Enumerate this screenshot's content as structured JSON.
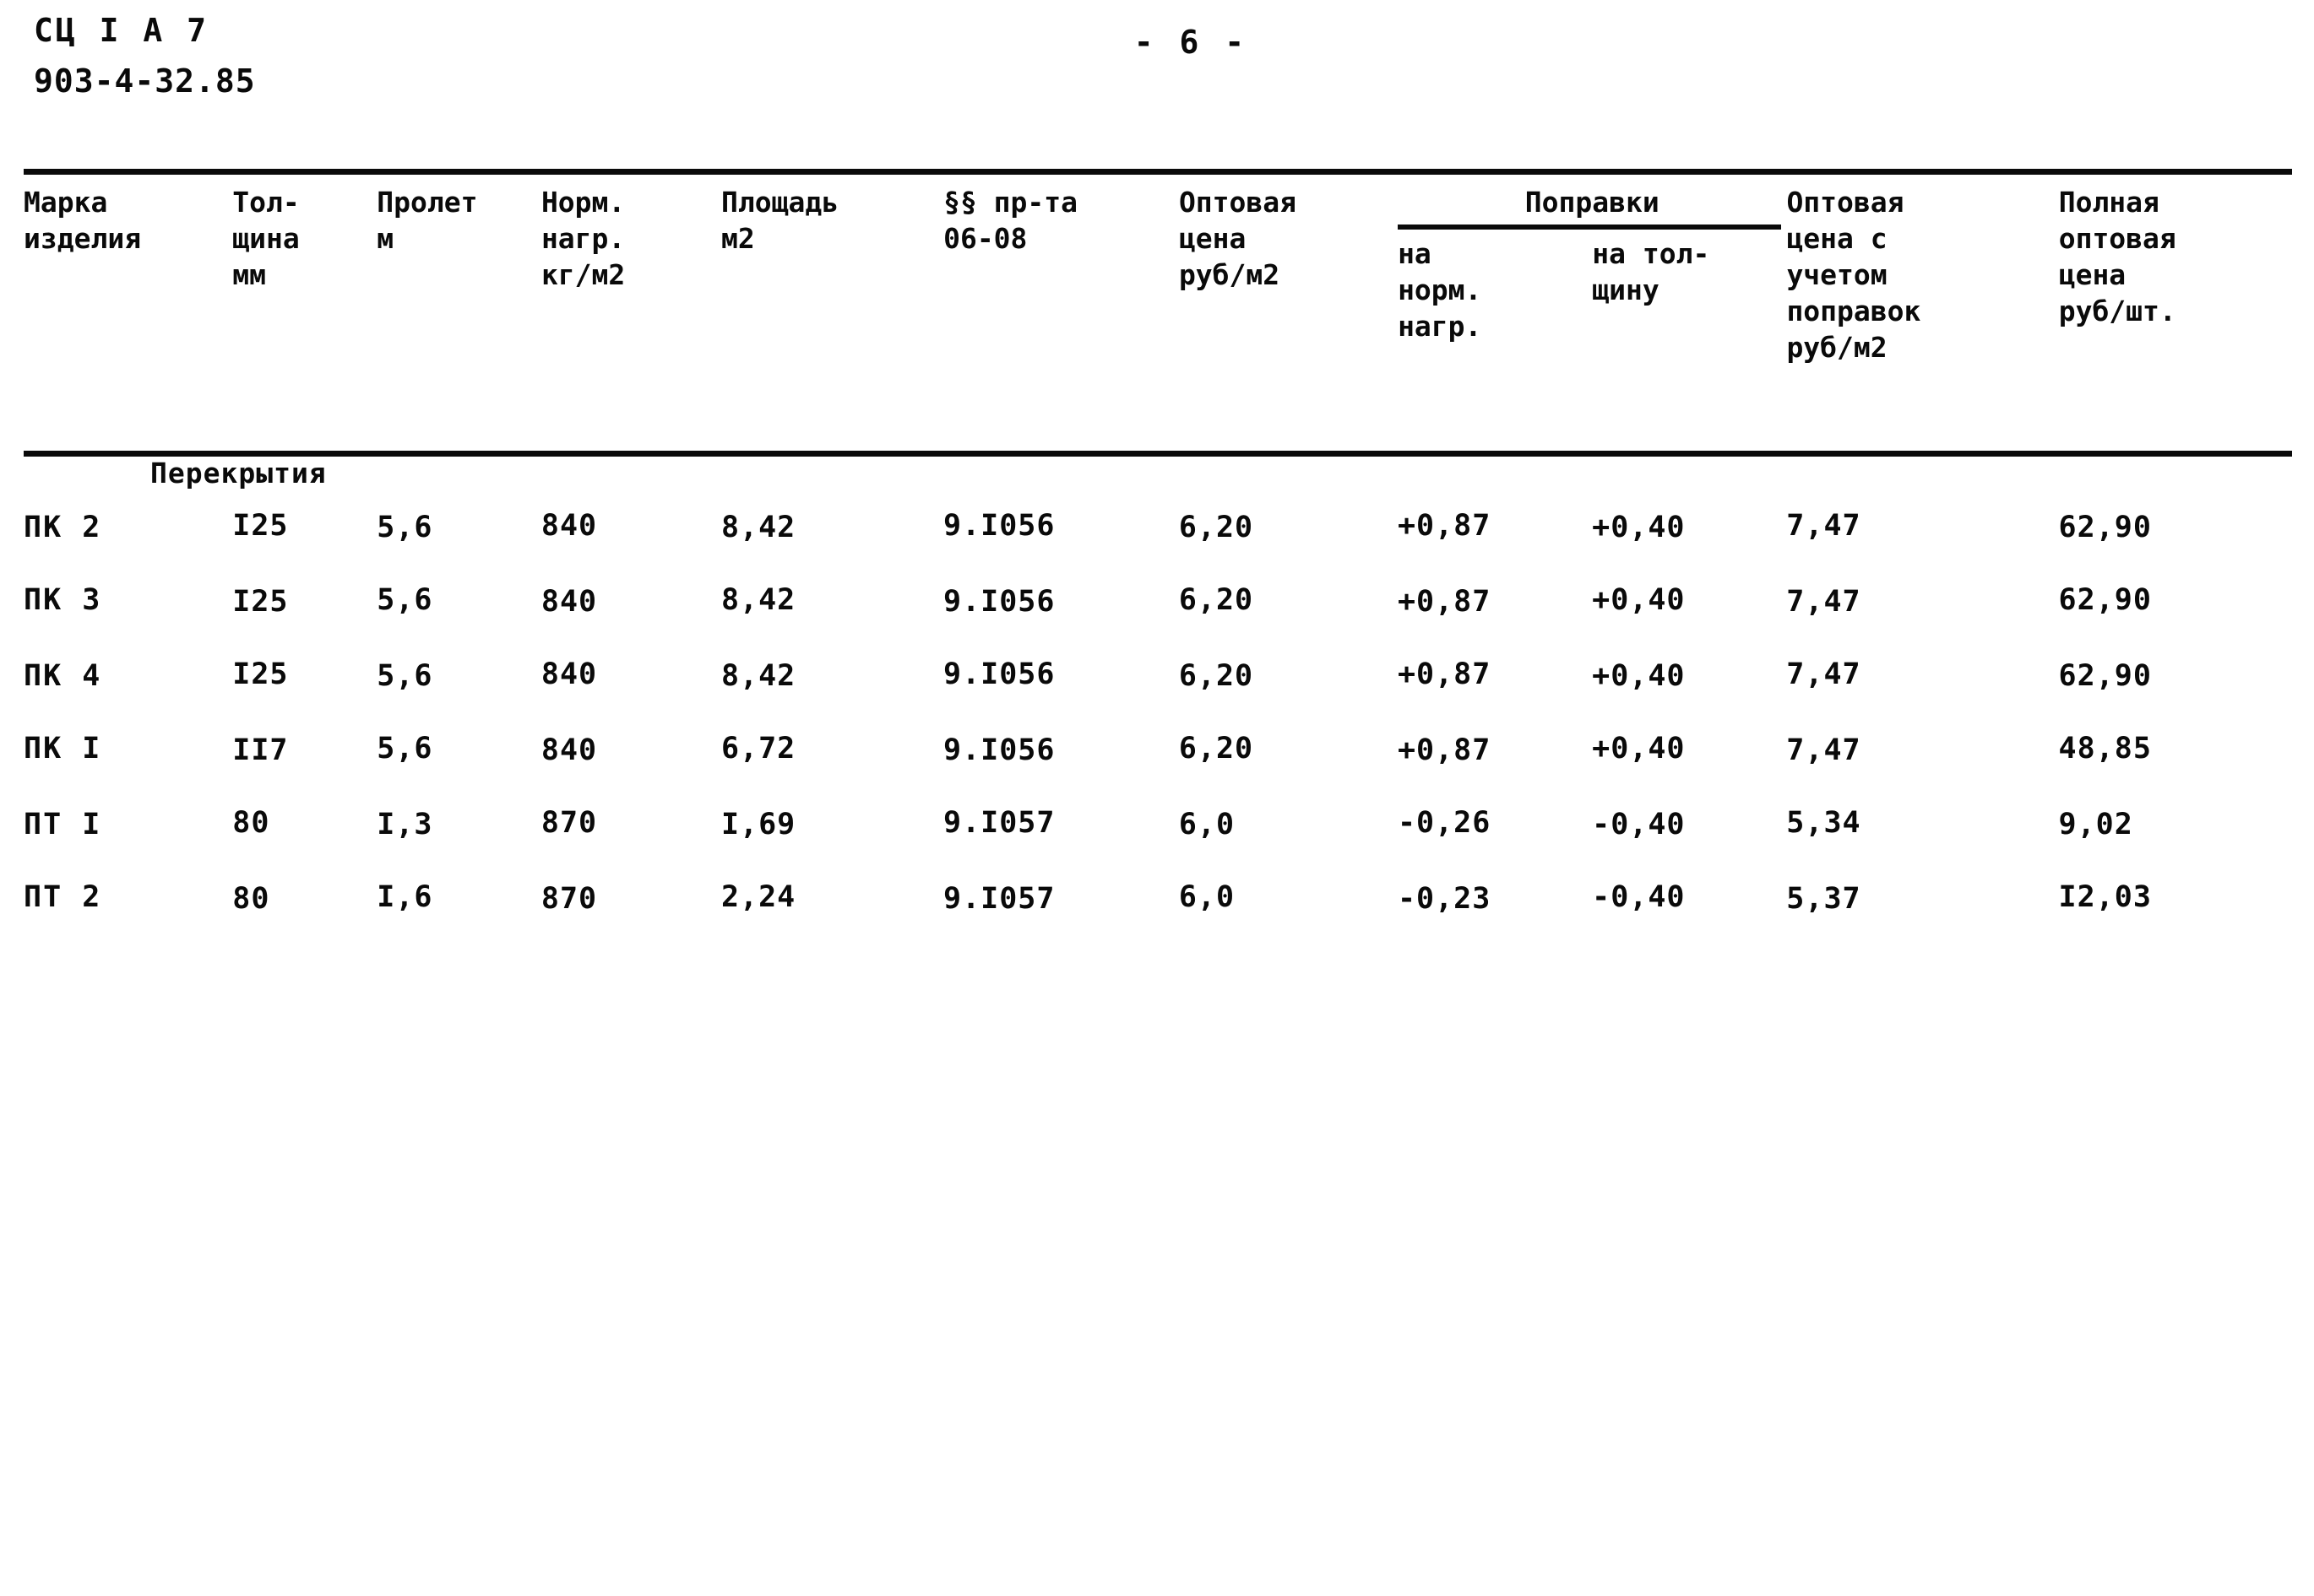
{
  "document": {
    "code": "СЦ I A 7",
    "series": "903-4-32.85",
    "page_number": "- 6 -"
  },
  "table": {
    "headers": {
      "mark": "Марка\nизделия",
      "thickness": "Тол-\nщина\nмм",
      "span": "Пролет\nм",
      "norm_load": "Норм.\nнагр.\nкг/м2",
      "area": "Площадь\nм2",
      "paragraphs": "§§ пр-та\n06-08",
      "wholesale_price": "Оптовая\nцена\nруб/м2",
      "corrections_group": "Поправки",
      "correction_load": "на\nнорм.\nнагр.",
      "correction_thickness": "на тол-\nщину",
      "price_with_corrections": "Оптовая\nцена с\nучетом\nпоправок\nруб/м2",
      "full_price": "Полная\nоптовая\nцена\nруб/шт."
    },
    "sections": [
      {
        "label": "Перекрытия",
        "rows": [
          {
            "mark": "ПК 2",
            "thickness": "I25",
            "span": "5,6",
            "norm_load": "840",
            "area": "8,42",
            "paragraphs": "9.I056",
            "wholesale_price": "6,20",
            "correction_load": "+0,87",
            "correction_thickness": "+0,40",
            "price_with_corrections": "7,47",
            "full_price": "62,90"
          },
          {
            "mark": "ПК 3",
            "thickness": "I25",
            "span": "5,6",
            "norm_load": "840",
            "area": "8,42",
            "paragraphs": "9.I056",
            "wholesale_price": "6,20",
            "correction_load": "+0,87",
            "correction_thickness": "+0,40",
            "price_with_corrections": "7,47",
            "full_price": "62,90"
          },
          {
            "mark": "ПК 4",
            "thickness": "I25",
            "span": "5,6",
            "norm_load": "840",
            "area": "8,42",
            "paragraphs": "9.I056",
            "wholesale_price": "6,20",
            "correction_load": "+0,87",
            "correction_thickness": "+0,40",
            "price_with_corrections": "7,47",
            "full_price": "62,90"
          },
          {
            "mark": "ПК I",
            "thickness": "II7",
            "span": "5,6",
            "norm_load": "840",
            "area": "6,72",
            "paragraphs": "9.I056",
            "wholesale_price": "6,20",
            "correction_load": "+0,87",
            "correction_thickness": "+0,40",
            "price_with_corrections": "7,47",
            "full_price": "48,85"
          },
          {
            "mark": "ПТ I",
            "thickness": "80",
            "span": "I,3",
            "norm_load": "870",
            "area": "I,69",
            "paragraphs": "9.I057",
            "wholesale_price": "6,0",
            "correction_load": "-0,26",
            "correction_thickness": "-0,40",
            "price_with_corrections": "5,34",
            "full_price": "9,02"
          },
          {
            "mark": "ПТ 2",
            "thickness": "80",
            "span": "I,6",
            "norm_load": "870",
            "area": "2,24",
            "paragraphs": "9.I057",
            "wholesale_price": "6,0",
            "correction_load": "-0,23",
            "correction_thickness": "-0,40",
            "price_with_corrections": "5,37",
            "full_price": "I2,03"
          }
        ]
      }
    ]
  }
}
